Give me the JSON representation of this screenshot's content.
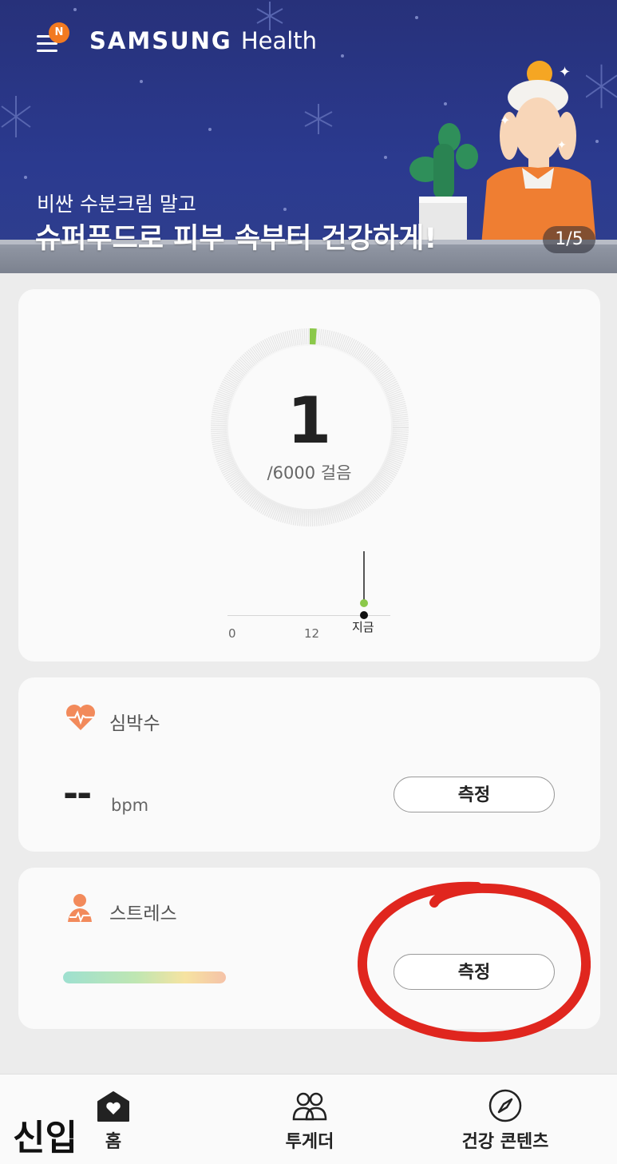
{
  "header": {
    "app_name": "SAMSUNG",
    "app_name_suffix": "Health",
    "notification_badge": "N",
    "banner_subtitle": "비싼 수분크림 말고",
    "banner_title": "슈퍼푸드로 피부 속부터 건강하게!",
    "banner_pager": "1/5"
  },
  "steps": {
    "count": "1",
    "goal": "/6000 걸음",
    "goal_progress": 0.0002,
    "accent_color": "#8bc84a",
    "timeline_labels": [
      "0",
      "12",
      "지금"
    ]
  },
  "heart_rate": {
    "label": "심박수",
    "value": "--",
    "unit": "bpm",
    "button_label": "측정",
    "icon": "heart-pulse-icon",
    "icon_color": "#f28a5b"
  },
  "stress": {
    "label": "스트레스",
    "button_label": "측정",
    "icon": "person-stress-icon",
    "icon_color": "#f28a5b"
  },
  "annotation": {
    "overlay_text": "신입",
    "circle_color": "#e0261e"
  },
  "bottom_nav": {
    "items": [
      {
        "label": "홈",
        "icon": "home-heart-icon"
      },
      {
        "label": "투게더",
        "icon": "people-icon"
      },
      {
        "label": "건강 콘텐츠",
        "icon": "compass-icon"
      }
    ]
  }
}
